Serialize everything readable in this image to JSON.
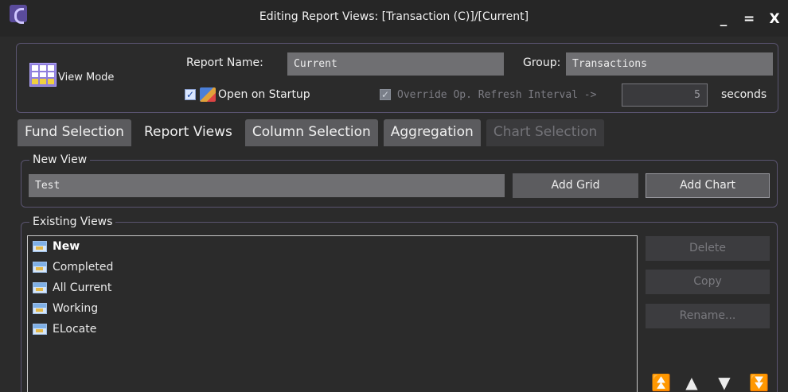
{
  "window": {
    "title": "Editing Report Views: [Transaction (C)]/[Current]",
    "controls": [
      "_",
      "=",
      "X"
    ]
  },
  "header": {
    "view_mode_label": "View Mode",
    "report_name_label": "Report Name:",
    "report_name_value": "Current",
    "group_label": "Group:",
    "group_value": "Transactions",
    "open_on_startup_label": "Open on Startup",
    "open_on_startup_checked": true,
    "override_label": "Override Op. Refresh Interval ->",
    "override_checked": true,
    "override_enabled": false,
    "refresh_value": "5",
    "seconds_label": "seconds"
  },
  "tabs": [
    {
      "label": "Fund Selection",
      "state": "normal"
    },
    {
      "label": "Report Views",
      "state": "active"
    },
    {
      "label": "Column Selection",
      "state": "normal"
    },
    {
      "label": "Aggregation",
      "state": "normal"
    },
    {
      "label": "Chart Selection",
      "state": "disabled"
    }
  ],
  "new_view": {
    "group_title": "New View",
    "input_value": "Test",
    "add_grid_label": "Add Grid",
    "add_chart_label": "Add Chart"
  },
  "existing_views": {
    "group_title": "Existing Views",
    "items": [
      {
        "label": "New",
        "bold": true
      },
      {
        "label": "Completed",
        "bold": false
      },
      {
        "label": "All Current",
        "bold": false
      },
      {
        "label": "Working",
        "bold": false
      },
      {
        "label": "ELocate",
        "bold": false
      }
    ],
    "delete_label": "Delete",
    "copy_label": "Copy",
    "rename_label": "Rename...",
    "arrows": [
      "move-top",
      "move-up",
      "move-down",
      "move-bottom"
    ]
  },
  "colors": {
    "background": "#2b2b2b",
    "panel_border": "#5a5470",
    "field_bg": "#6f6f72",
    "accent": "#8f7fdd"
  }
}
